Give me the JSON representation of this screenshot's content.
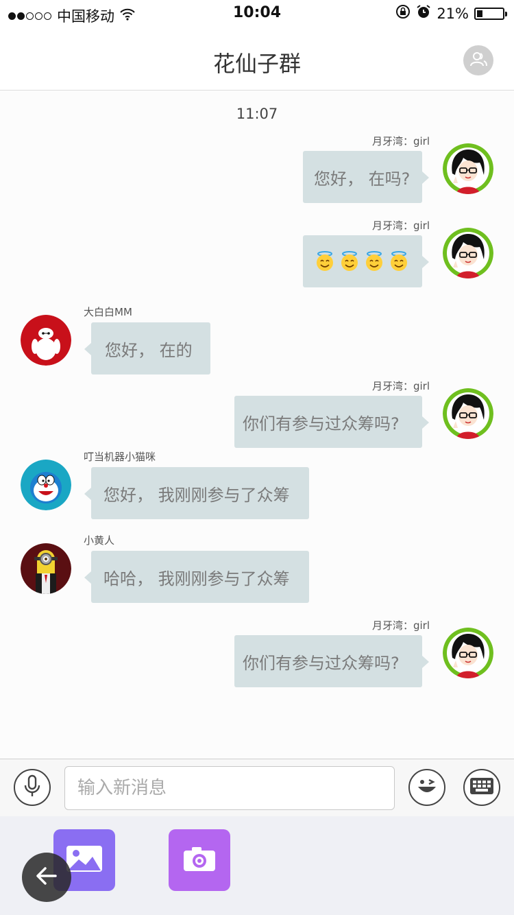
{
  "status_bar": {
    "carrier": "中国移动",
    "time": "10:04",
    "battery_text": "21%",
    "battery_level": 0.21,
    "signal_strength": 2,
    "icons": [
      "signal-dots-icon",
      "wifi-icon",
      "rotation-lock-icon",
      "alarm-icon",
      "battery-icon"
    ]
  },
  "nav": {
    "title": "花仙子群",
    "right_icon": "group-members-icon"
  },
  "chat": {
    "time_label": "11:07",
    "messages": [
      {
        "side": "me",
        "sender": "月牙湾：girl",
        "text": "您好， 在吗?",
        "avatar": "girl-avatar"
      },
      {
        "side": "me",
        "sender": "月牙湾：girl",
        "emoji": [
          "halo-smile",
          "halo-smile",
          "halo-smile",
          "halo-smile"
        ],
        "avatar": "girl-avatar"
      },
      {
        "side": "other",
        "sender": "大白白MM",
        "text": "您好， 在的",
        "avatar": "baymax-avatar"
      },
      {
        "side": "me",
        "sender": "月牙湾：girl",
        "text": "你们有参与过众筹吗?",
        "avatar": "girl-avatar"
      },
      {
        "side": "other",
        "sender": "叮当机器小猫咪",
        "text": "您好， 我刚刚参与了众筹",
        "avatar": "doraemon-avatar"
      },
      {
        "side": "other",
        "sender": "小黄人",
        "text": "哈哈， 我刚刚参与了众筹",
        "avatar": "minion-avatar"
      },
      {
        "side": "me",
        "sender": "月牙湾：girl",
        "text": "你们有参与过众筹吗?",
        "avatar": "girl-avatar"
      }
    ]
  },
  "input_bar": {
    "placeholder": "输入新消息",
    "left_icon": "microphone-icon",
    "right_icons": [
      "emoji-wink-icon",
      "keyboard-icon"
    ]
  },
  "tray": {
    "tools": [
      "image-icon",
      "camera-icon"
    ],
    "colors": {
      "image": "#8a6ef2",
      "camera": "#b466f0"
    }
  },
  "floating": {
    "back_icon": "back-arrow-icon"
  },
  "colors": {
    "bubble": "#d4e0e2",
    "girl_avatar_ring": "#6fbf1f",
    "baymax_bg": "#c8101a",
    "doraemon_bg": "#1aa7c4"
  }
}
